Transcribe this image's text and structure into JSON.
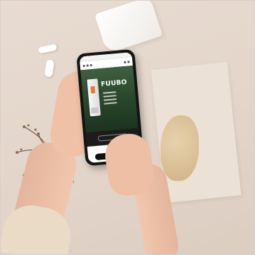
{
  "scene": {
    "phone": {
      "brand_text": "FUUBO",
      "accent_color": "#e57a3a",
      "chat_color": "#3ea9e0"
    }
  },
  "icons": {
    "chat": "chat-bubble-icon"
  }
}
